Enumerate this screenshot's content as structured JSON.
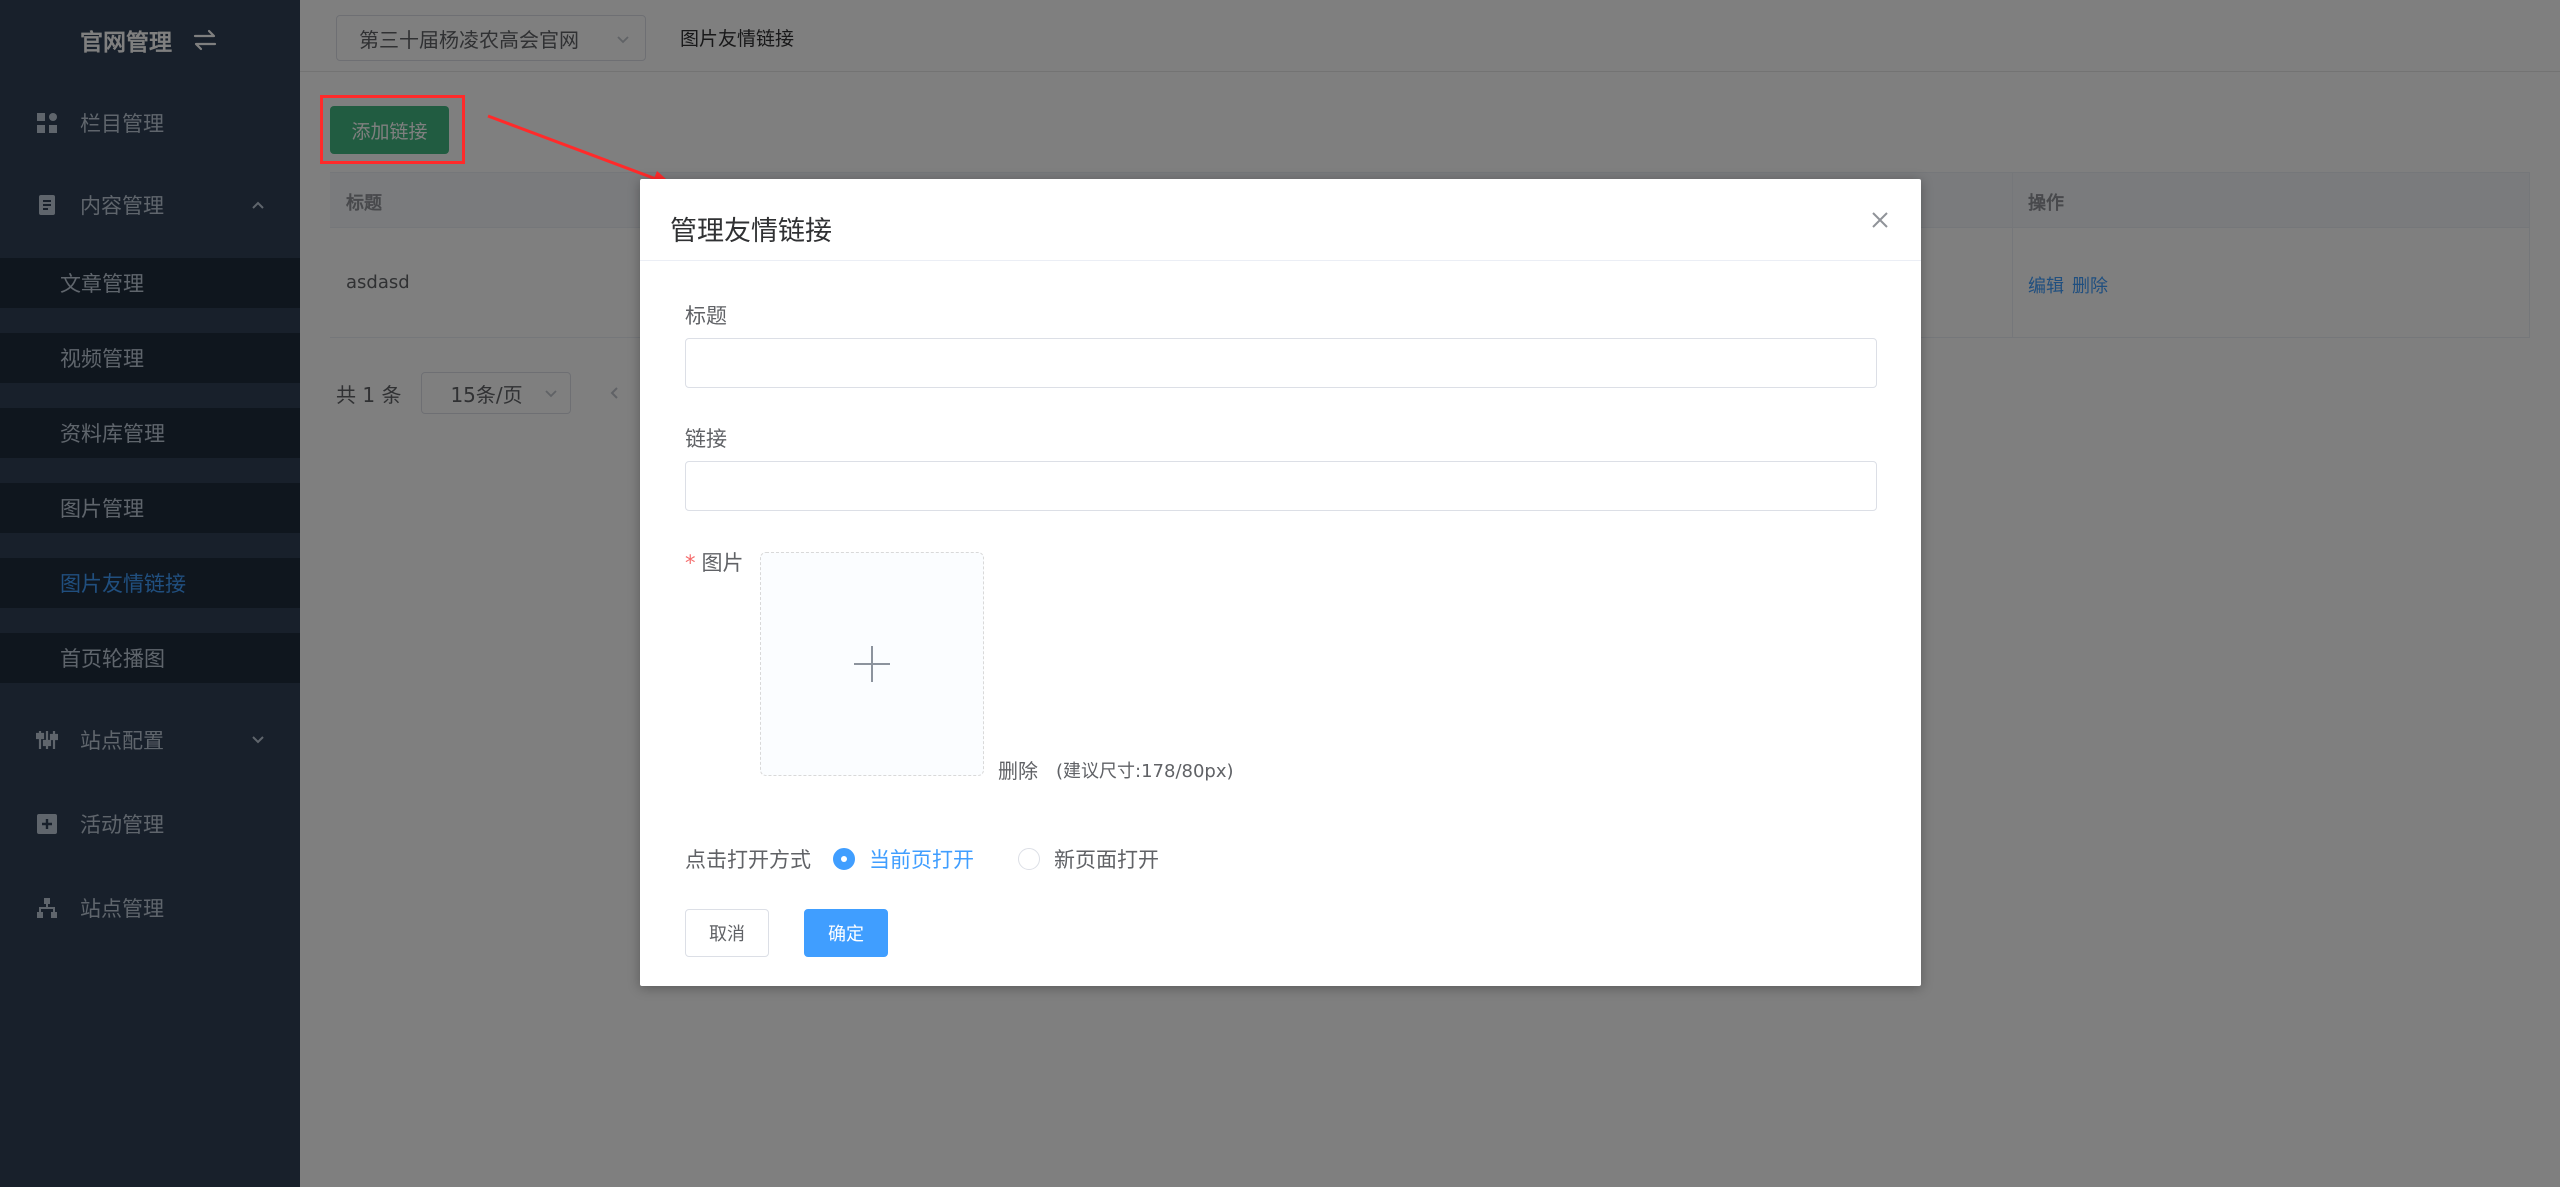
{
  "sidebar": {
    "title": "官网管理",
    "menu": [
      {
        "label": "栏目管理",
        "icon": "grid-icon"
      },
      {
        "label": "内容管理",
        "icon": "document-icon",
        "expanded": true
      },
      {
        "label": "站点配置",
        "icon": "sliders-icon"
      },
      {
        "label": "活动管理",
        "icon": "calendar-plus-icon"
      },
      {
        "label": "站点管理",
        "icon": "sitemap-icon"
      }
    ],
    "submenu": [
      "文章管理",
      "视频管理",
      "资料库管理",
      "图片管理",
      "图片友情链接",
      "首页轮播图"
    ],
    "active_submenu": "图片友情链接"
  },
  "header": {
    "site_select_value": "第三十届杨凌农高会官网",
    "breadcrumb": "图片友情链接"
  },
  "toolbar": {
    "add_label": "添加链接"
  },
  "table": {
    "columns": [
      "标题",
      "操作"
    ],
    "rows": [
      {
        "title": "asdasd",
        "edit": "编辑",
        "delete": "删除"
      }
    ]
  },
  "pagination": {
    "total_text": "共 1 条",
    "page_size": "15条/页"
  },
  "dialog": {
    "title": "管理友情链接",
    "title_label": "标题",
    "title_value": "",
    "link_label": "链接",
    "link_value": "",
    "image_required_mark": "*",
    "image_label": "图片",
    "delete_label": "删除",
    "size_hint": "(建议尺寸:178/80px)",
    "open_mode_label": "点击打开方式",
    "open_mode_options": [
      "当前页打开",
      "新页面打开"
    ],
    "open_mode_selected": "当前页打开",
    "cancel_label": "取消",
    "confirm_label": "确定"
  },
  "colors": {
    "sidebar_bg": "#304156",
    "submenu_bg": "#1f2d3d",
    "active": "#409eff",
    "add_button": "#42b983",
    "annotation": "#ff2a2a"
  }
}
